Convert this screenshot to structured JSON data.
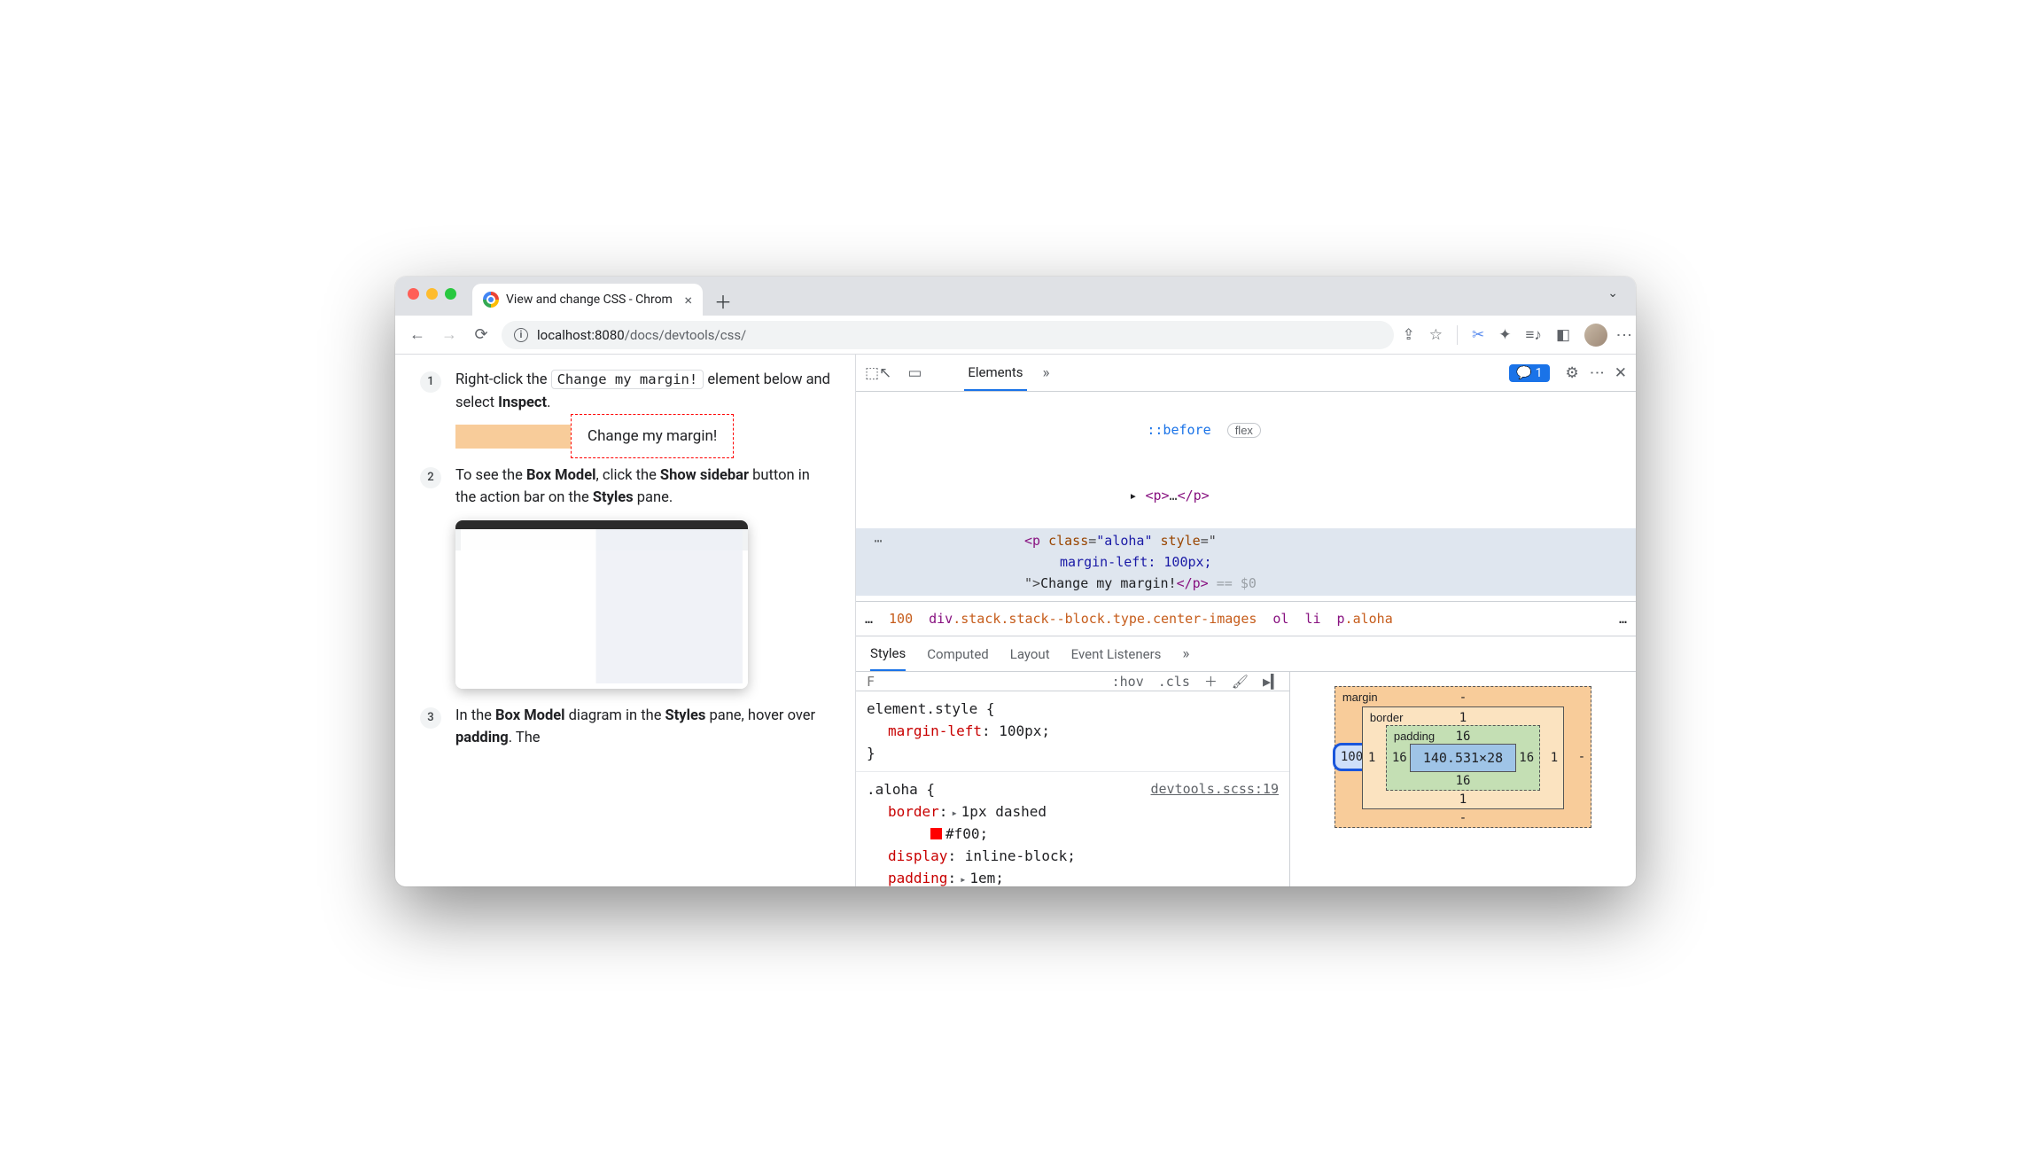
{
  "tab": {
    "title": "View and change CSS - Chrom"
  },
  "url": {
    "host": "localhost:",
    "port": "8080",
    "path": "/docs/devtools/css/"
  },
  "steps": {
    "s1": {
      "num": "1",
      "t1": "Right-click the ",
      "chip": "Change my margin!",
      "t2": " element below and select ",
      "bold": "Inspect",
      "t3": "."
    },
    "demo": "Change my margin!",
    "s2": {
      "num": "2",
      "t1": "To see the ",
      "b1": "Box Model",
      "t2": ", click the ",
      "b2": "Show sidebar",
      "t3": " button in the action bar on the ",
      "b3": "Styles",
      "t4": " pane."
    },
    "s3": {
      "num": "3",
      "t1": "In the ",
      "b1": "Box Model",
      "t2": " diagram in the ",
      "b2": "Styles",
      "t3": " pane, hover over ",
      "b3": "padding",
      "t4": ". The"
    }
  },
  "devtools": {
    "tabs": {
      "elements": "Elements"
    },
    "issues_count": "1",
    "dom": {
      "before": "::before",
      "flex": "flex",
      "p1": "<p>…</p>",
      "sel_open1": "<p ",
      "sel_class_k": "class",
      "sel_class_v": "\"aloha\"",
      "sel_style_k": "style",
      "sel_style_v1": "margin-left: 100px;",
      "sel_text": "Change my margin!",
      "sel_close": "</p>",
      "eq0": " == $0"
    },
    "crumbs": {
      "ell": "…",
      "num": "100",
      "c1": "div.stack.stack--block.type.center-images",
      "c2": "ol",
      "c3": "li",
      "c4": "p.aloha",
      "more": "…"
    },
    "stabs": {
      "styles": "Styles",
      "computed": "Computed",
      "layout": "Layout",
      "el": "Event Listeners"
    },
    "filter": {
      "placeholder": "F",
      "hov": ":hov",
      "cls": ".cls"
    },
    "rules": {
      "r1_sel": "element.style {",
      "r1_p1_k": "margin-left",
      "r1_p1_v": "100px",
      "r1_close": "}",
      "r2_sel": ".aloha {",
      "r2_src": "devtools.scss:19",
      "r2_p1_k": "border",
      "r2_p1_v": "1px dashed",
      "r2_p1_c": "#f00",
      "r2_p2_k": "display",
      "r2_p2_v": "inline-block",
      "r2_p3_k": "padding",
      "r2_p3_v": "1em"
    },
    "box": {
      "margin_lbl": "margin",
      "border_lbl": "border",
      "padding_lbl": "padding",
      "content": "140.531×28",
      "m_t": "-",
      "m_b": "-",
      "m_l": "100",
      "m_r": "-",
      "b_t": "1",
      "b_b": "1",
      "b_l": "1",
      "b_r": "1",
      "p_t": "16",
      "p_b": "16",
      "p_l": "16",
      "p_r": "16"
    }
  }
}
